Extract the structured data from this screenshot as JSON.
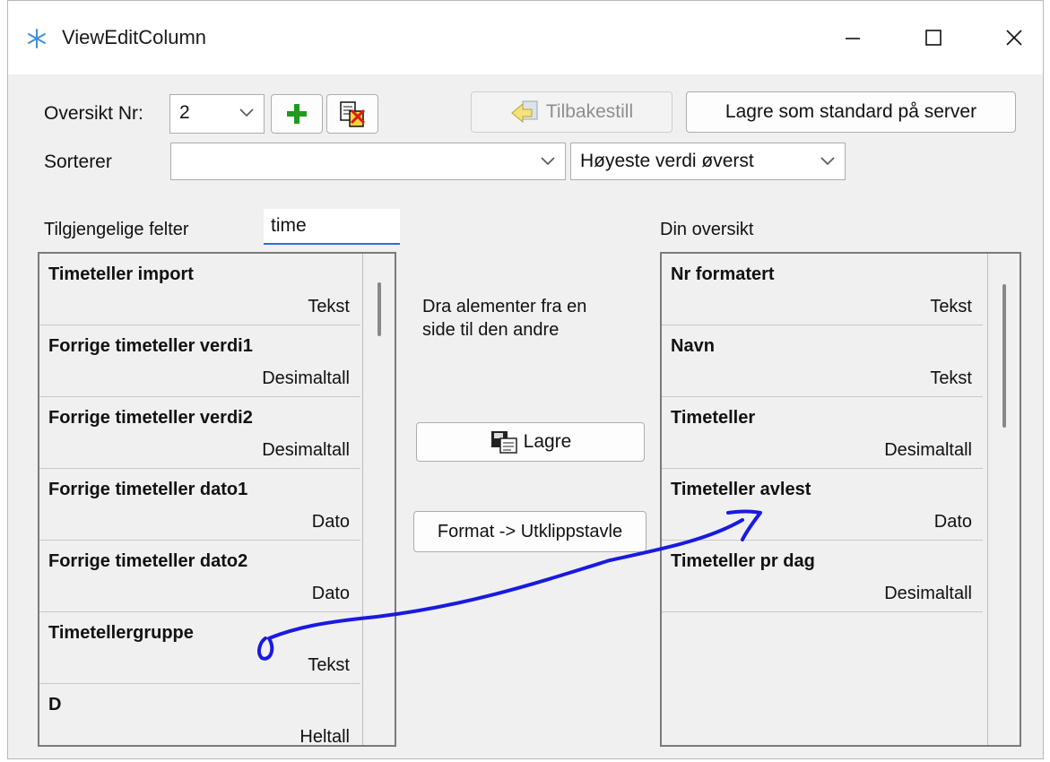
{
  "window": {
    "title": "ViewEditColumn"
  },
  "top": {
    "oversikt_label": "Oversikt Nr:",
    "oversikt_value": "2",
    "reset_label": "Tilbakestill",
    "save_server_label": "Lagre som standard på server",
    "sorter_label": "Sorterer",
    "sorter_value": "",
    "order_value": "Høyeste verdi øverst"
  },
  "available": {
    "label": "Tilgjengelige felter",
    "filter_value": "time",
    "items": [
      {
        "name": "Timeteller import",
        "type": "Tekst"
      },
      {
        "name": "Forrige timeteller verdi1",
        "type": "Desimaltall"
      },
      {
        "name": "Forrige timeteller verdi2",
        "type": "Desimaltall"
      },
      {
        "name": "Forrige timeteller dato1",
        "type": "Dato"
      },
      {
        "name": "Forrige timeteller dato2",
        "type": "Dato"
      },
      {
        "name": "Timetellergruppe",
        "type": "Tekst"
      },
      {
        "name": "D",
        "type": "Heltall"
      }
    ]
  },
  "middle": {
    "hint": [
      "Dra alementer fra en",
      "side til den andre"
    ],
    "save_label": "Lagre",
    "format_label": "Format -> Utklippstavle"
  },
  "selected": {
    "label": "Din oversikt",
    "items": [
      {
        "name": "Nr formatert",
        "type": "Tekst"
      },
      {
        "name": "Navn",
        "type": "Tekst"
      },
      {
        "name": "Timeteller",
        "type": "Desimaltall"
      },
      {
        "name": "Timeteller avlest",
        "type": "Dato"
      },
      {
        "name": "Timeteller pr dag",
        "type": "Desimaltall"
      }
    ]
  },
  "colors": {
    "accent": "#2b6fd6",
    "annotation": "#1a1adf",
    "plus": "#1f9a1f"
  }
}
